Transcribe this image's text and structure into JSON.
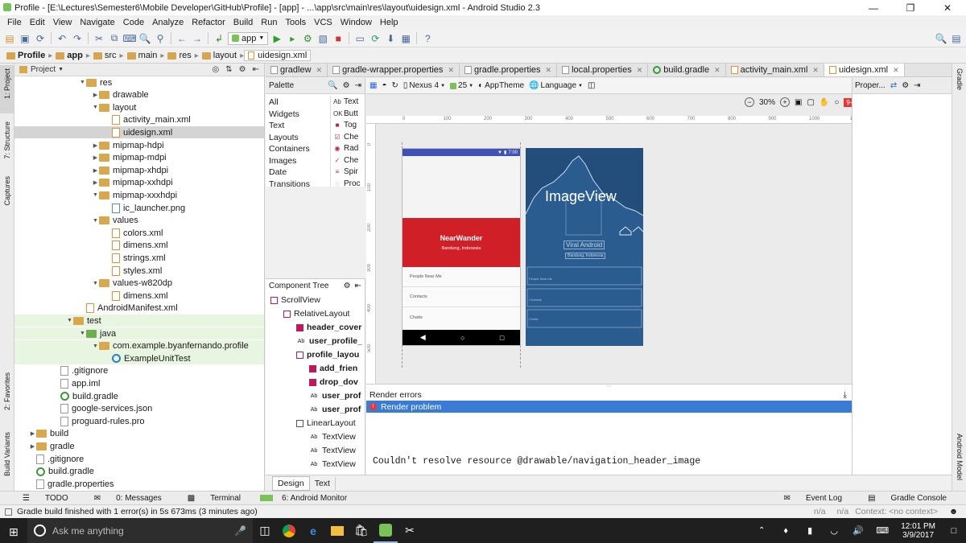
{
  "window": {
    "title": "Profile - [E:\\Lectures\\Semester6\\Mobile Developer\\GitHub\\Profile] - [app] - ...\\app\\src\\main\\res\\layout\\uidesign.xml - Android Studio 2.3"
  },
  "menu": [
    "File",
    "Edit",
    "View",
    "Navigate",
    "Code",
    "Analyze",
    "Refactor",
    "Build",
    "Run",
    "Tools",
    "VCS",
    "Window",
    "Help"
  ],
  "toolbar": {
    "run_config": "app"
  },
  "breadcrumb": [
    "Profile",
    "app",
    "src",
    "main",
    "res",
    "layout",
    "uidesign.xml"
  ],
  "left_strip": {
    "project": "1: Project",
    "structure": "7: Structure",
    "captures": "Captures",
    "favorites": "2: Favorites",
    "build_variants": "Build Variants"
  },
  "right_strip": {
    "gradle": "Gradle",
    "android_model": "Android Model"
  },
  "project_panel": {
    "header": "Project",
    "tree": [
      {
        "label": "res",
        "depth": 1,
        "type": "folder",
        "expanded": true
      },
      {
        "label": "drawable",
        "depth": 2,
        "type": "folder",
        "expanded": false
      },
      {
        "label": "layout",
        "depth": 2,
        "type": "folder",
        "expanded": true
      },
      {
        "label": "activity_main.xml",
        "depth": 3,
        "type": "xml"
      },
      {
        "label": "uidesign.xml",
        "depth": 3,
        "type": "xml",
        "selected": true
      },
      {
        "label": "mipmap-hdpi",
        "depth": 2,
        "type": "folder",
        "expanded": false
      },
      {
        "label": "mipmap-mdpi",
        "depth": 2,
        "type": "folder",
        "expanded": false
      },
      {
        "label": "mipmap-xhdpi",
        "depth": 2,
        "type": "folder",
        "expanded": false
      },
      {
        "label": "mipmap-xxhdpi",
        "depth": 2,
        "type": "folder",
        "expanded": false
      },
      {
        "label": "mipmap-xxxhdpi",
        "depth": 2,
        "type": "folder",
        "expanded": true
      },
      {
        "label": "ic_launcher.png",
        "depth": 3,
        "type": "png"
      },
      {
        "label": "values",
        "depth": 2,
        "type": "folder",
        "expanded": true
      },
      {
        "label": "colors.xml",
        "depth": 3,
        "type": "xml"
      },
      {
        "label": "dimens.xml",
        "depth": 3,
        "type": "xml"
      },
      {
        "label": "strings.xml",
        "depth": 3,
        "type": "xml"
      },
      {
        "label": "styles.xml",
        "depth": 3,
        "type": "xml"
      },
      {
        "label": "values-w820dp",
        "depth": 2,
        "type": "folder",
        "expanded": true
      },
      {
        "label": "dimens.xml",
        "depth": 3,
        "type": "xml"
      },
      {
        "label": "AndroidManifest.xml",
        "depth": 1,
        "type": "xml"
      },
      {
        "label": "test",
        "depth": 0,
        "type": "folder",
        "expanded": true,
        "green": true
      },
      {
        "label": "java",
        "depth": 1,
        "type": "folder-green",
        "expanded": true,
        "green": true
      },
      {
        "label": "com.example.byanfernando.profile",
        "depth": 2,
        "type": "folder",
        "expanded": true,
        "green": true
      },
      {
        "label": "ExampleUnitTest",
        "depth": 3,
        "type": "class",
        "green": true
      },
      {
        "label": ".gitignore",
        "depth": -1,
        "type": "file"
      },
      {
        "label": "app.iml",
        "depth": -1,
        "type": "file"
      },
      {
        "label": "build.gradle",
        "depth": -1,
        "type": "gradle"
      },
      {
        "label": "google-services.json",
        "depth": -1,
        "type": "file"
      },
      {
        "label": "proguard-rules.pro",
        "depth": -1,
        "type": "file"
      },
      {
        "label": "build",
        "depth": -2,
        "type": "folder",
        "expanded": false
      },
      {
        "label": "gradle",
        "depth": -2,
        "type": "folder",
        "expanded": false
      },
      {
        "label": ".gitignore",
        "depth": -2,
        "type": "file"
      },
      {
        "label": "build.gradle",
        "depth": -2,
        "type": "gradle"
      },
      {
        "label": "gradle.properties",
        "depth": -2,
        "type": "file"
      }
    ]
  },
  "editor_tabs": [
    {
      "label": "gradlew",
      "active": false
    },
    {
      "label": "gradle-wrapper.properties",
      "active": false
    },
    {
      "label": "gradle.properties",
      "active": false
    },
    {
      "label": "local.properties",
      "active": false
    },
    {
      "label": "build.gradle",
      "active": false
    },
    {
      "label": "activity_main.xml",
      "active": false
    },
    {
      "label": "uidesign.xml",
      "active": true
    }
  ],
  "designer": {
    "palette_title": "Palette",
    "device": "Nexus 4",
    "api": "25",
    "theme": "AppTheme",
    "language": "Language",
    "zoom": "30%",
    "properties_title": "Proper...",
    "palette_categories": [
      "All",
      "Widgets",
      "Text",
      "Layouts",
      "Containers",
      "Images",
      "Date",
      "Transitions"
    ],
    "palette_items": [
      {
        "icon": "Ab",
        "label": "Text"
      },
      {
        "icon": "OK",
        "label": "Butt"
      },
      {
        "icon": "■",
        "label": "Tog"
      },
      {
        "icon": "☑",
        "label": "Che"
      },
      {
        "icon": "◉",
        "label": "Rad"
      },
      {
        "icon": "✓",
        "label": "Che"
      },
      {
        "icon": "≡",
        "label": "Spir"
      },
      {
        "icon": "◌",
        "label": "Proc"
      }
    ],
    "ruler_h": [
      "0",
      "100",
      "200",
      "300",
      "400",
      "500",
      "600",
      "700",
      "800",
      "900",
      "1000",
      "11"
    ],
    "ruler_v": [
      "0",
      "100",
      "200",
      "300",
      "400",
      "500"
    ],
    "component_tree_title": "Component Tree",
    "tree": [
      {
        "label": "ScrollView",
        "indent": 0,
        "bold": false
      },
      {
        "label": "RelativeLayout",
        "indent": 1,
        "bold": false
      },
      {
        "label": "header_cover",
        "indent": 2,
        "bold": true
      },
      {
        "label": "user_profile_",
        "indent": 2,
        "bold": true
      },
      {
        "label": "profile_layou",
        "indent": 2,
        "bold": true
      },
      {
        "label": "add_frien",
        "indent": 3,
        "bold": true
      },
      {
        "label": "drop_dov",
        "indent": 3,
        "bold": true
      },
      {
        "label": "user_prof",
        "indent": 3,
        "bold": true
      },
      {
        "label": "user_prof",
        "indent": 3,
        "bold": true
      },
      {
        "label": "LinearLayout",
        "indent": 2,
        "bold": false
      },
      {
        "label": "TextView",
        "indent": 3,
        "bold": false
      },
      {
        "label": "TextView",
        "indent": 3,
        "bold": false
      },
      {
        "label": "TextView",
        "indent": 3,
        "bold": false
      }
    ],
    "phone": {
      "time": "7:00",
      "name": "NearWander",
      "location": "Bandung, Indonesia",
      "rows": [
        "People Near Me",
        "Contacts",
        "Chatts"
      ],
      "accent": "#d01f26",
      "status_bar": "#3f51b5"
    },
    "blueprint": {
      "image_label": "ImageView",
      "name": "Viral Android",
      "location": "Bandung, Indonesia",
      "rows": [
        "People Near Me",
        "Contacts",
        "Chatts"
      ],
      "bg": "#2b5c8f"
    },
    "errors": {
      "title": "Render errors",
      "item": "Render problem",
      "message": "Couldn't resolve resource @drawable/navigation_header_image"
    },
    "bottom_tabs": [
      "Design",
      "Text"
    ]
  },
  "tool_windows": {
    "todo": "TODO",
    "messages": "0: Messages",
    "terminal": "Terminal",
    "monitor": "6: Android Monitor",
    "event_log": "Event Log",
    "gradle_console": "Gradle Console"
  },
  "status": {
    "message": "Gradle build finished with 1 error(s) in 5s 673ms (3 minutes ago)",
    "na1": "n/a",
    "na2": "n/a",
    "context": "Context: <no context>"
  },
  "taskbar": {
    "search": "Ask me anything",
    "time": "12:01 PM",
    "date": "3/9/2017"
  }
}
